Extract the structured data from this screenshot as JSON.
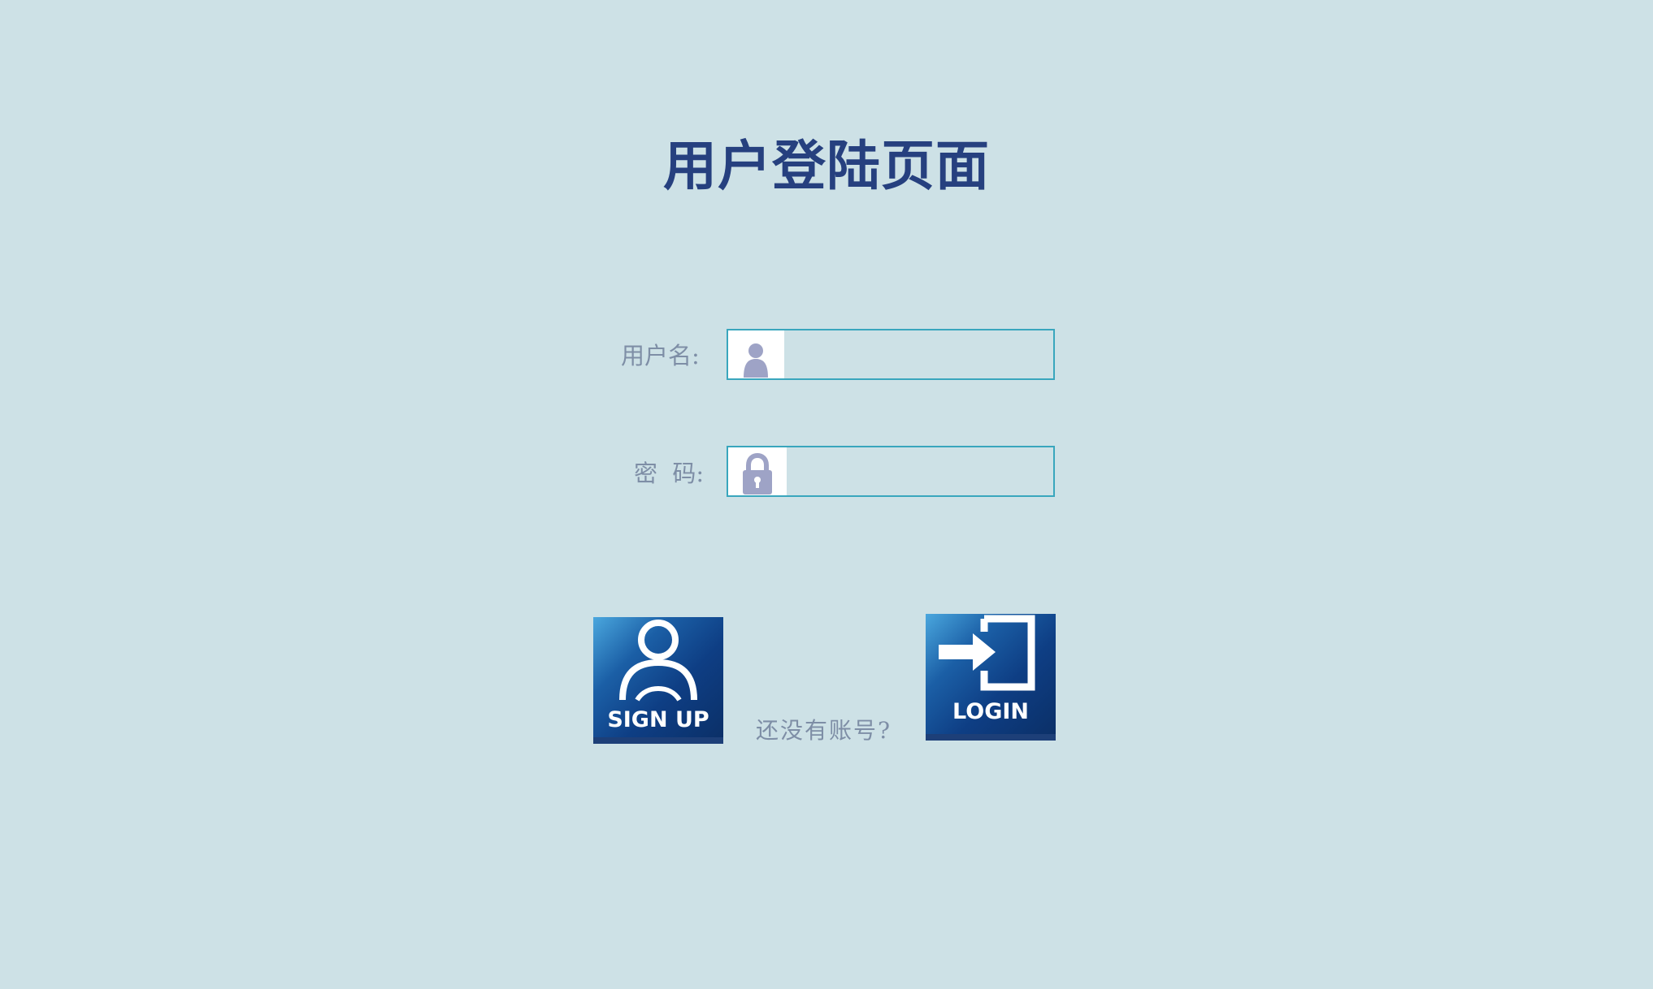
{
  "page": {
    "title": "用户登陆页面"
  },
  "form": {
    "username": {
      "label": "用户名:",
      "value": "",
      "icon": "user-icon"
    },
    "password": {
      "label": "密  码:",
      "value": "",
      "icon": "lock-icon"
    }
  },
  "actions": {
    "signup_label": "SIGN UP",
    "signup_icon": "user-signup-icon",
    "hint": "还没有账号?",
    "login_label": "LOGIN",
    "login_icon": "login-arrow-icon"
  },
  "colors": {
    "background": "#cde1e6",
    "title": "#26407f",
    "label": "#7e8ea6",
    "field_border": "#39a6bd",
    "button_dark": "#0b2f66",
    "button_light": "#4aa7de"
  }
}
